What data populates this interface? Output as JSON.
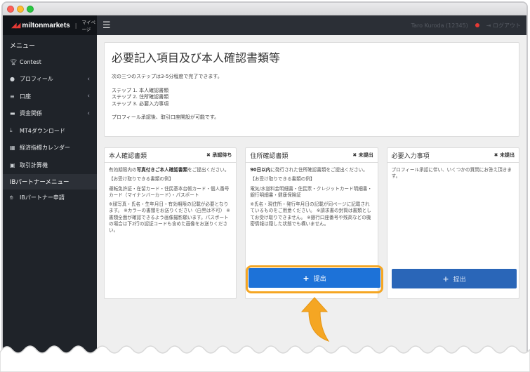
{
  "brand": {
    "name": "miltonmarkets",
    "link": "マイページ"
  },
  "topnav": {
    "menu_icon": "hamburger-icon",
    "user": "Taro Kuroda (12345)",
    "logout": "ログアウト"
  },
  "sidebar": {
    "heading": "メニュー",
    "items": [
      {
        "icon": "trophy-icon",
        "label": "Contest",
        "chevron": false
      },
      {
        "icon": "user-icon",
        "label": "プロフィール",
        "chevron": true
      },
      {
        "icon": "list-icon",
        "label": "口座",
        "chevron": true
      },
      {
        "icon": "wallet-icon",
        "label": "資金関係",
        "chevron": true
      },
      {
        "icon": "download-icon",
        "label": "MT4ダウンロード",
        "chevron": false
      },
      {
        "icon": "calendar-icon",
        "label": "経済指標カレンダー",
        "chevron": false
      },
      {
        "icon": "calculator-icon",
        "label": "取引計算機",
        "chevron": false
      }
    ],
    "section": "IBパートナーメニュー",
    "partner_item": {
      "icon": "handshake-icon",
      "label": "IBパートナー申請"
    }
  },
  "intro": {
    "title": "必要記入項目及び本人確認書類等",
    "lead": "次の三つのステップは3-5分程度で完了できます。",
    "steps": [
      "ステップ 1. 本人確認書類",
      "ステップ 2. 住所確認書類",
      "ステップ 3. 必要入力事項"
    ],
    "note": "プロフィール承認後、取引口座開設が可能です。"
  },
  "cards": [
    {
      "title": "本人確認書類",
      "status": "✖ 承認待ち",
      "body": [
        "有効期限内の写真付きご本人確認書類をご提出ください。",
        "【お受け取りできる書類の例】",
        "運転免許証・在留カード・住民基本台帳カード・個人番号カード（マイナンバーカード）・パスポート",
        "※顔写真・氏名・生年月日・有効期限の記載が必要となります。 ※カラーの書類をお送りください（白黒は不可） ※書類全面が確認できるよう画像撮影願います。パスポートの場合は下2行の認証コードも含めた画像をお送りください。"
      ]
    },
    {
      "title": "住所確認書類",
      "status": "✖ 未提出",
      "body": [
        "90日以内に発行された住所確認書類をご提出ください。",
        "【お受け取りできる書類の例】",
        "電気/水道料金明細書・住民票・クレジットカード明細書・銀行明細書・健康保険証",
        "※氏名・現住所・発行年月日の記載が同ページに記載されているものをご用意ください。 ※請求書の封筒は書類としてお受け取りできません。 ※銀行口座番号や残高などの機密情報は隠した状態でも構いません。"
      ],
      "button": "提出"
    },
    {
      "title": "必要入力事項",
      "status": "✖ 未提出",
      "body": [
        "プロフィール承認に伴い、いくつかの質問にお答え頂きます。"
      ],
      "button": "提出"
    }
  ],
  "colors": {
    "accent": "#1d72d8",
    "highlight": "#f5a623",
    "sidebar": "#1f2329"
  }
}
